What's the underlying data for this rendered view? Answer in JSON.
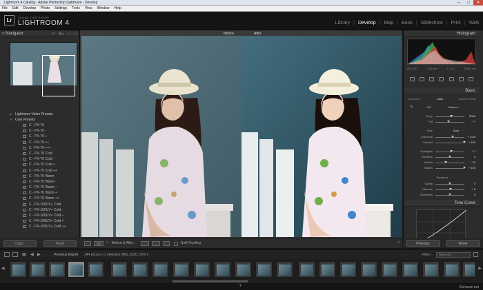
{
  "window": {
    "title": "Lightroom 4 Catalog - Adobe Photoshop Lightroom - Develop",
    "min": "–",
    "max": "□",
    "close": "✕"
  },
  "menu": [
    "File",
    "Edit",
    "Develop",
    "Photo",
    "Settings",
    "Tools",
    "View",
    "Window",
    "Help"
  ],
  "identity": {
    "logo": "Lr",
    "subtitle": "ADOBE PHOTOSHOP",
    "product": "LIGHTROOM 4"
  },
  "modules": [
    {
      "label": "Library",
      "active": false
    },
    {
      "label": "Develop",
      "active": true
    },
    {
      "label": "Map",
      "active": false
    },
    {
      "label": "Book",
      "active": false
    },
    {
      "label": "Slideshow",
      "active": false
    },
    {
      "label": "Print",
      "active": false
    },
    {
      "label": "Web",
      "active": false
    }
  ],
  "navigator": {
    "title": "Navigator",
    "modes": [
      "FIT",
      "FILL",
      "1:1",
      "3:1"
    ],
    "active_mode": "FILL"
  },
  "presets": {
    "folders": [
      "Lightroom Video Presets",
      "User Presets"
    ],
    "items": [
      "C - PX-70",
      "C - PX-70 -",
      "C - PX-70 +",
      "C - PX-70 ++",
      "C - PX-70 +++",
      "C - PX-70 Cold",
      "C - PX-70 Cold -",
      "C - PX-70 Cold +",
      "C - PX-70 Cold ++",
      "C - PX-70 Warm",
      "C - PX-70 Warm -",
      "C - PX-70 Warm --",
      "C - PX-70 Warm +",
      "C - PX-70 Warm ++",
      "C - PX-100UV+ Cold",
      "C - PX-100UV+ Cold -",
      "C - PX-100UV+ Cold --",
      "C - PX-100UV+ Cold +",
      "C - PX-100UV+ Cold ++"
    ]
  },
  "left_buttons": {
    "copy": "Copy...",
    "paste": "Paste"
  },
  "view": {
    "before_label": "Before",
    "after_label": "After"
  },
  "toolbar": {
    "yy": "Y|Y",
    "before_after": "Before & After :",
    "soft_proofing": "Soft Proofing"
  },
  "right_panel": {
    "histogram_title": "Histogram",
    "histogram_info": [
      "ISO 100",
      "135 mm",
      "f / 3.2",
      "1/500 sec"
    ],
    "basic_title": "Basic",
    "treatment": "Treatment :",
    "treatment_options": [
      "Color",
      "Black & White"
    ],
    "treatment_selected": "Color",
    "wb_label": "WB :",
    "wb_value": "Custom ÷",
    "tone_label": "Tone",
    "tone_auto": "Auto",
    "presence_label": "Presence",
    "tone_curve_title": "Tone Curve"
  },
  "sliders": [
    {
      "label": "Temp",
      "value": "5000",
      "pos": 0.55
    },
    {
      "label": "Tint",
      "value": "− 7",
      "pos": 0.45
    },
    {
      "label": "Exposure",
      "value": "+ 0.85",
      "pos": 0.6
    },
    {
      "label": "Contrast",
      "value": "+ 100",
      "pos": 1.0
    },
    {
      "label": "Highlights",
      "value": "+ 7",
      "pos": 0.54
    },
    {
      "label": "Shadows",
      "value": "0",
      "pos": 0.5
    },
    {
      "label": "Whites",
      "value": "− 30",
      "pos": 0.35
    },
    {
      "label": "Blacks",
      "value": "+ 100",
      "pos": 1.0
    },
    {
      "label": "Clarity",
      "value": "0",
      "pos": 0.5
    },
    {
      "label": "Vibrance",
      "value": "+ 5",
      "pos": 0.53
    },
    {
      "label": "Saturation",
      "value": "0",
      "pos": 0.5
    }
  ],
  "right_buttons": {
    "previous": "Previous",
    "reset": "Reset"
  },
  "filmbar": {
    "source": "Previous Import",
    "count": "144 photos / 1 selected /IMG_8181.CR2 ▾",
    "filter_label": "Filter :",
    "filter_value": "Filters Off"
  },
  "watermark": "Dohoavn.net",
  "colors": {
    "panel": "#2c2c2c",
    "accent": "#eeeeee",
    "close": "#c94b3d"
  }
}
